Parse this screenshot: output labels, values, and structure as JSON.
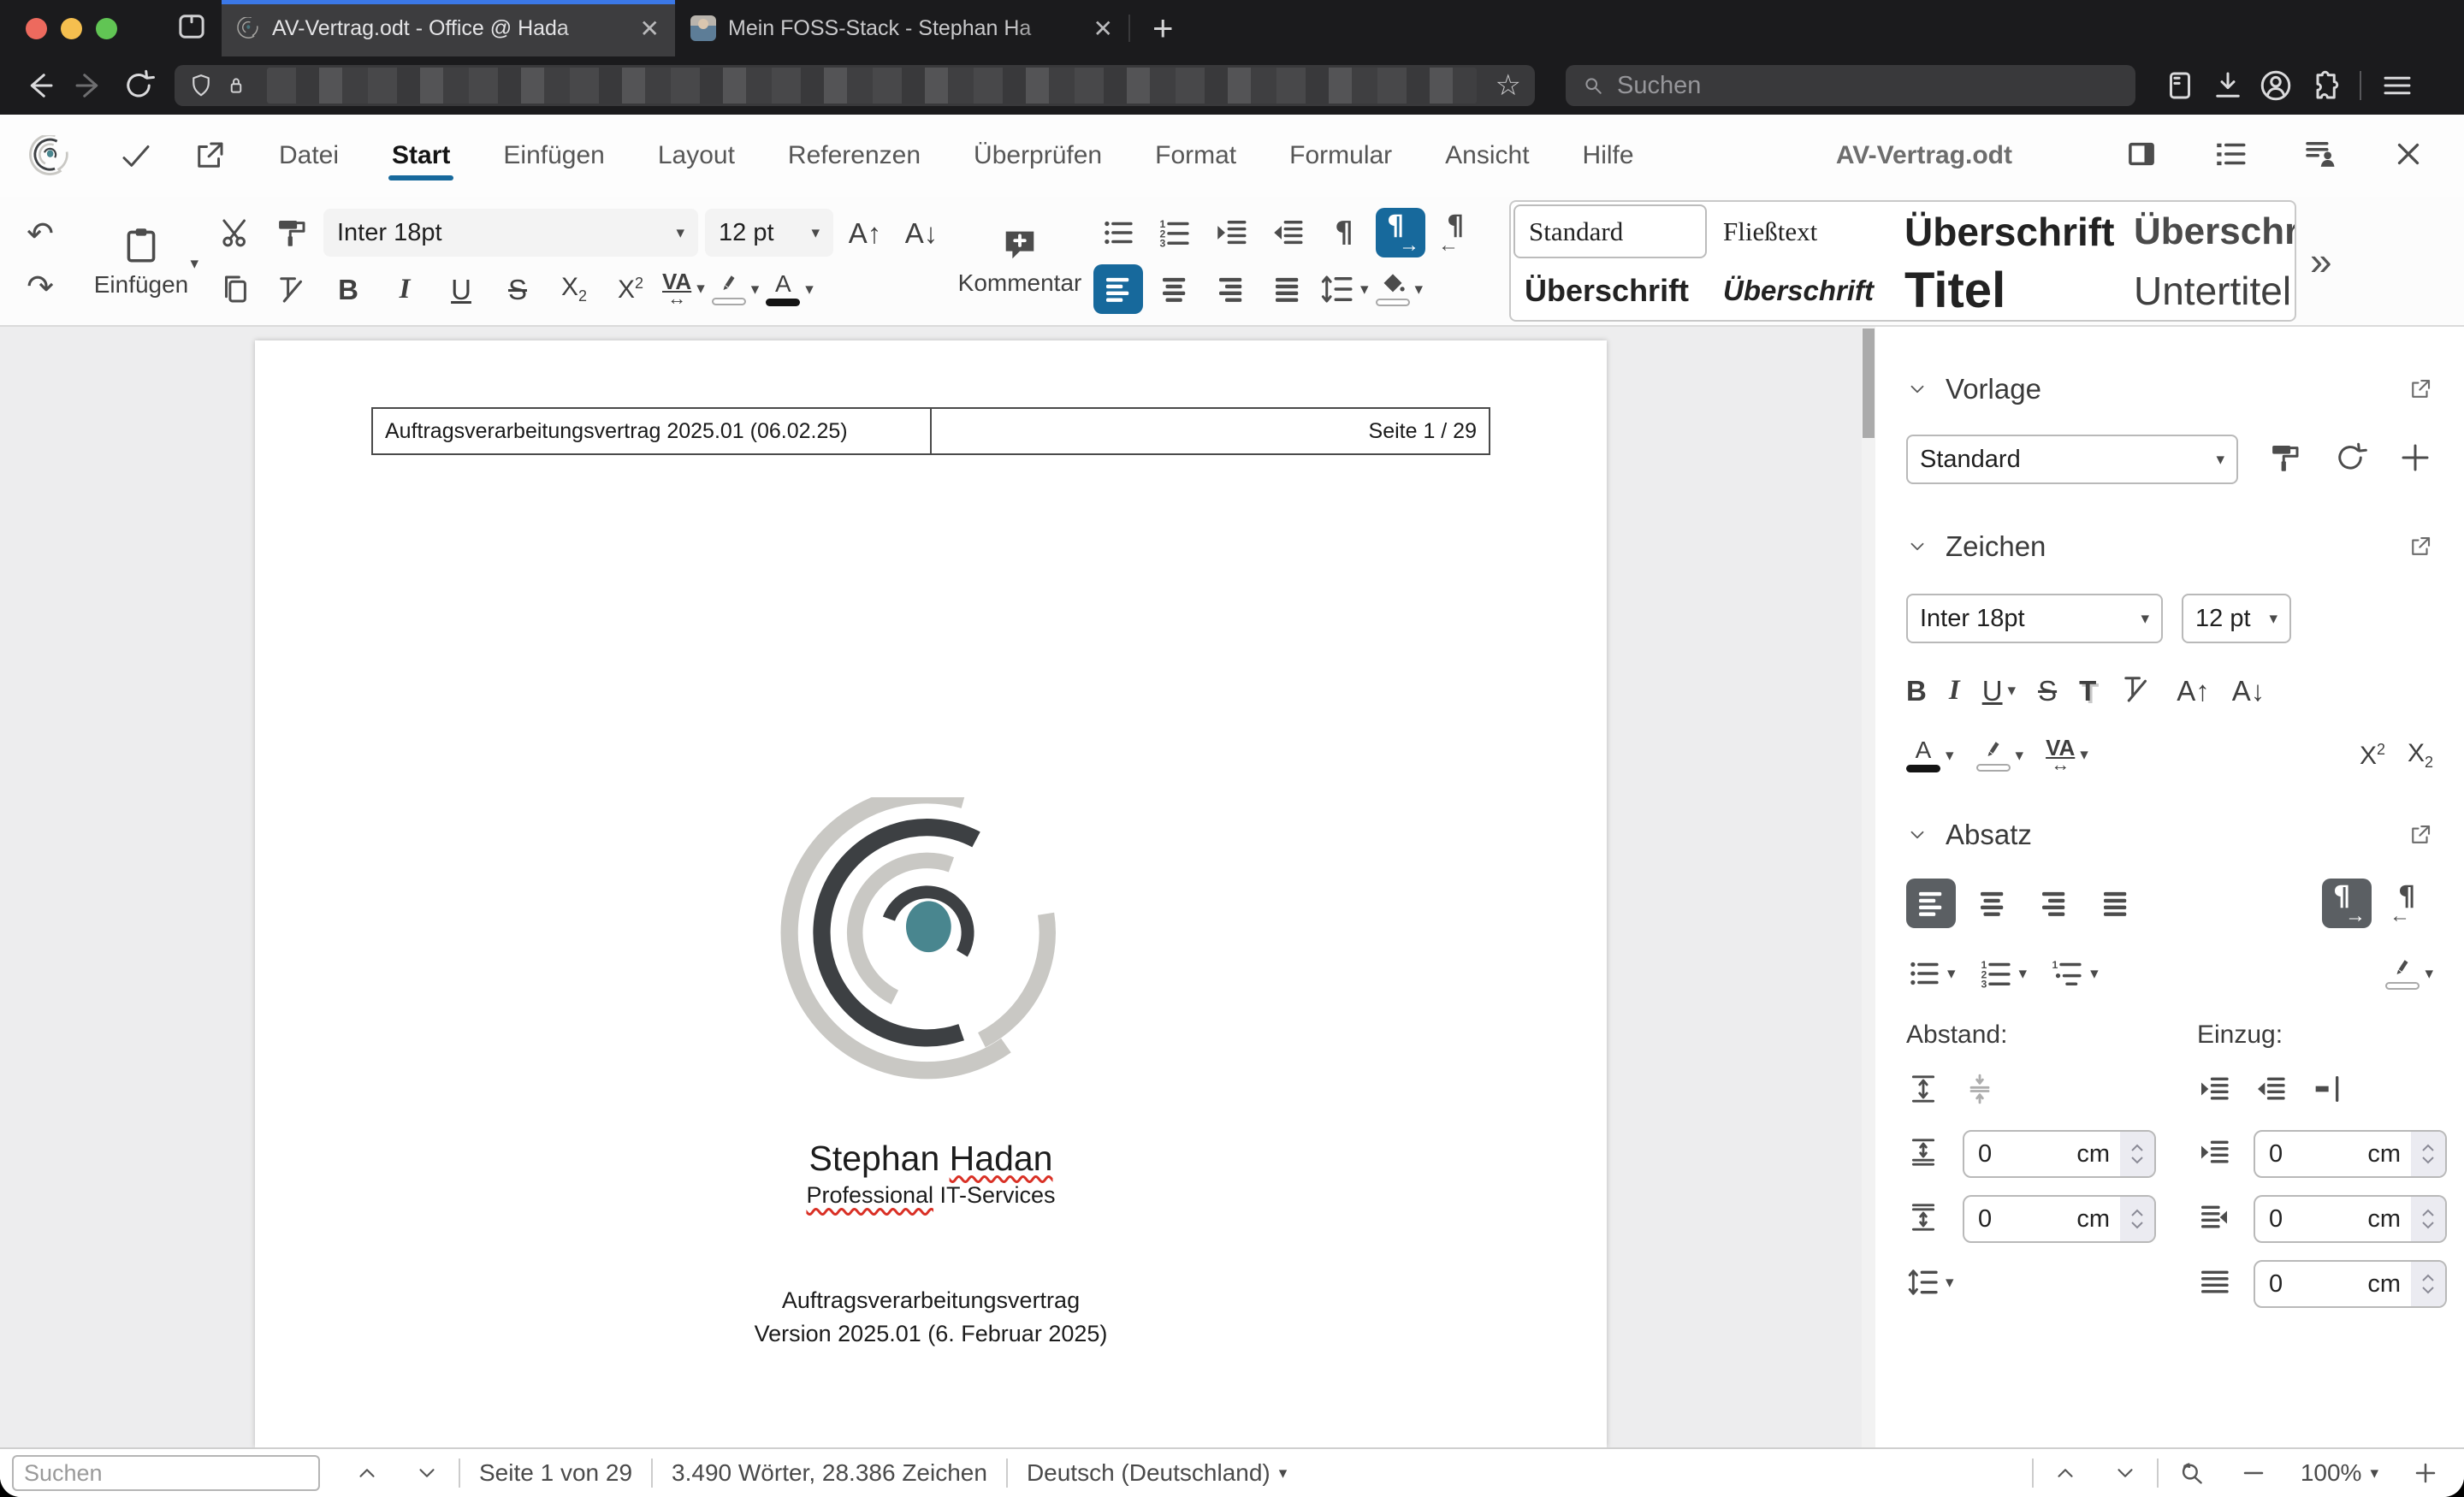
{
  "colors": {
    "accent": "#17699c",
    "tab_accent": "#3b78e7",
    "squiggle": "#d93025",
    "logo_dark": "#3d4043",
    "logo_light": "#c9c8c4",
    "logo_teal": "#49868f"
  },
  "browser": {
    "tabs": [
      {
        "title": "AV-Vertrag.odt - Office @ Hada"
      },
      {
        "title": "Mein FOSS-Stack - Stephan Ha"
      }
    ],
    "search_placeholder": "Suchen"
  },
  "menu": {
    "items": [
      "Datei",
      "Start",
      "Einfügen",
      "Layout",
      "Referenzen",
      "Überprüfen",
      "Format",
      "Formular",
      "Ansicht",
      "Hilfe"
    ],
    "doc_title": "AV-Vertrag.odt"
  },
  "toolbar": {
    "paste_label": "Einfügen",
    "comment_label": "Kommentar",
    "font_name": "Inter 18pt",
    "font_size": "12 pt",
    "styles": [
      {
        "label": "Standard"
      },
      {
        "label": "Fließtext"
      },
      {
        "label": "Überschrift"
      },
      {
        "label": "Überschrift"
      },
      {
        "label": "Überschrift"
      },
      {
        "label": "Überschrift"
      },
      {
        "label": "Titel"
      },
      {
        "label": "Untertitel"
      }
    ]
  },
  "sidebar": {
    "vorlage": {
      "title": "Vorlage",
      "value": "Standard"
    },
    "zeichen": {
      "title": "Zeichen",
      "font_name": "Inter 18pt",
      "font_size": "12 pt"
    },
    "absatz": {
      "title": "Absatz",
      "abstand_label": "Abstand:",
      "einzug_label": "Einzug:",
      "abstand_values": [
        {
          "value": "0",
          "unit": "cm"
        },
        {
          "value": "0",
          "unit": "cm"
        }
      ],
      "einzug_values": [
        {
          "value": "0",
          "unit": "cm"
        },
        {
          "value": "0",
          "unit": "cm"
        },
        {
          "value": "0",
          "unit": "cm"
        }
      ]
    }
  },
  "document": {
    "header_left": "Auftragsverarbeitungsvertrag 2025.01 (06.02.25)",
    "header_right": "Seite 1 / 29",
    "title_part1": "Stephan ",
    "title_part2": "Hadan",
    "subtitle_part1": "Professional",
    "subtitle_part2": " IT-Services",
    "body_line1": "Auftragsverarbeitungsvertrag",
    "body_line2": "Version 2025.01 (6. Februar 2025)"
  },
  "statusbar": {
    "search_placeholder": "Suchen",
    "page": "Seite 1 von 29",
    "words": "3.490 Wörter, 28.386 Zeichen",
    "language": "Deutsch (Deutschland)",
    "zoom": "100%"
  }
}
